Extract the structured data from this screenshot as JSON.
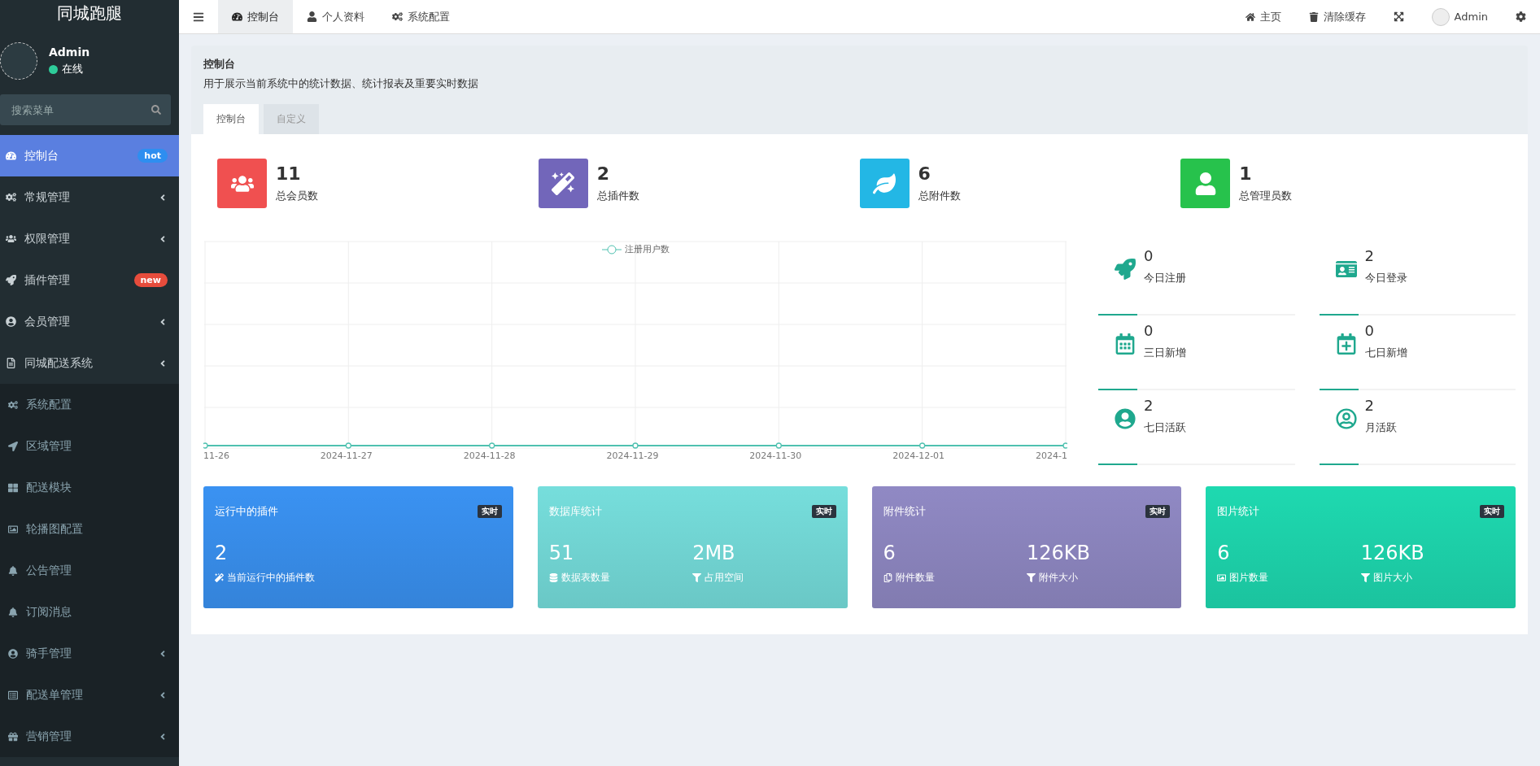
{
  "sidebar": {
    "logo": "同城跑腿",
    "user": {
      "name": "Admin",
      "status": "在线",
      "online": true
    },
    "search": {
      "placeholder": "搜索菜单"
    },
    "menu": [
      {
        "label": "控制台",
        "selected": true,
        "collapsible": false,
        "badge": {
          "text": "hot",
          "color": "#2e8ef0"
        }
      },
      {
        "label": "常规管理",
        "selected": false,
        "collapsible": true
      },
      {
        "label": "权限管理",
        "selected": false,
        "collapsible": true
      },
      {
        "label": "插件管理",
        "selected": false,
        "collapsible": false,
        "badge": {
          "text": "new",
          "color": "#e74c3c"
        }
      },
      {
        "label": "会员管理",
        "selected": false,
        "collapsible": true
      },
      {
        "label": "同城配送系统",
        "selected": false,
        "collapsible": true,
        "expanded": true,
        "children": [
          {
            "label": "系统配置",
            "selected": false,
            "collapsible": false
          },
          {
            "label": "区域管理",
            "selected": false,
            "collapsible": false
          },
          {
            "label": "配送模块",
            "selected": false,
            "collapsible": false
          },
          {
            "label": "轮播图配置",
            "selected": false,
            "collapsible": false
          },
          {
            "label": "公告管理",
            "selected": false,
            "collapsible": false
          },
          {
            "label": "订阅消息",
            "selected": false,
            "collapsible": false
          },
          {
            "label": "骑手管理",
            "selected": false,
            "collapsible": true
          },
          {
            "label": "配送单管理",
            "selected": false,
            "collapsible": true
          },
          {
            "label": "营销管理",
            "selected": false,
            "collapsible": true
          }
        ]
      }
    ]
  },
  "topbar": {
    "tabs": [
      {
        "label": "控制台",
        "selected": true
      },
      {
        "label": "个人资料",
        "selected": false
      },
      {
        "label": "系统配置",
        "selected": false
      }
    ],
    "links": [
      "主页",
      "清除缓存"
    ],
    "user": "Admin"
  },
  "page_header": {
    "title": "控制台",
    "description": "用于展示当前系统中的统计数据、统计报表及重要实时数据",
    "tabs": [
      {
        "label": "控制台",
        "selected": true
      },
      {
        "label": "自定义",
        "selected": false
      }
    ]
  },
  "stats": [
    {
      "value": "11",
      "label": "总会员数",
      "color": "#f05050"
    },
    {
      "value": "2",
      "label": "总插件数",
      "color": "#7266ba"
    },
    {
      "value": "6",
      "label": "总附件数",
      "color": "#23b7e5"
    },
    {
      "value": "1",
      "label": "总管理员数",
      "color": "#27c24c"
    }
  ],
  "chart": {
    "legend": "注册用户数",
    "x_labels": [
      "11-26",
      "2024-11-27",
      "2024-11-28",
      "2024-11-29",
      "2024-11-30",
      "2024-12-01",
      "2024-1"
    ]
  },
  "mini_stats": [
    {
      "value": "0",
      "label": "今日注册"
    },
    {
      "value": "2",
      "label": "今日登录"
    },
    {
      "value": "0",
      "label": "三日新增"
    },
    {
      "value": "0",
      "label": "七日新增"
    },
    {
      "value": "2",
      "label": "七日活跃"
    },
    {
      "value": "2",
      "label": "月活跃"
    }
  ],
  "cards": [
    {
      "title": "运行中的插件",
      "badge": "实时",
      "color": "#3a92f2",
      "metrics": [
        {
          "value": "2",
          "label": "当前运行中的插件数"
        }
      ]
    },
    {
      "title": "数据库统计",
      "badge": "实时",
      "color": "#76dedc",
      "metrics": [
        {
          "value": "51",
          "label": "数据表数量"
        },
        {
          "value": "2MB",
          "label": "占用空间"
        }
      ]
    },
    {
      "title": "附件统计",
      "badge": "实时",
      "color": "#9089c4",
      "metrics": [
        {
          "value": "6",
          "label": "附件数量"
        },
        {
          "value": "126KB",
          "label": "附件大小"
        }
      ]
    },
    {
      "title": "图片统计",
      "badge": "实时",
      "color": "#1ed9b0",
      "metrics": [
        {
          "value": "6",
          "label": "图片数量"
        },
        {
          "value": "126KB",
          "label": "图片大小"
        }
      ]
    }
  ]
}
